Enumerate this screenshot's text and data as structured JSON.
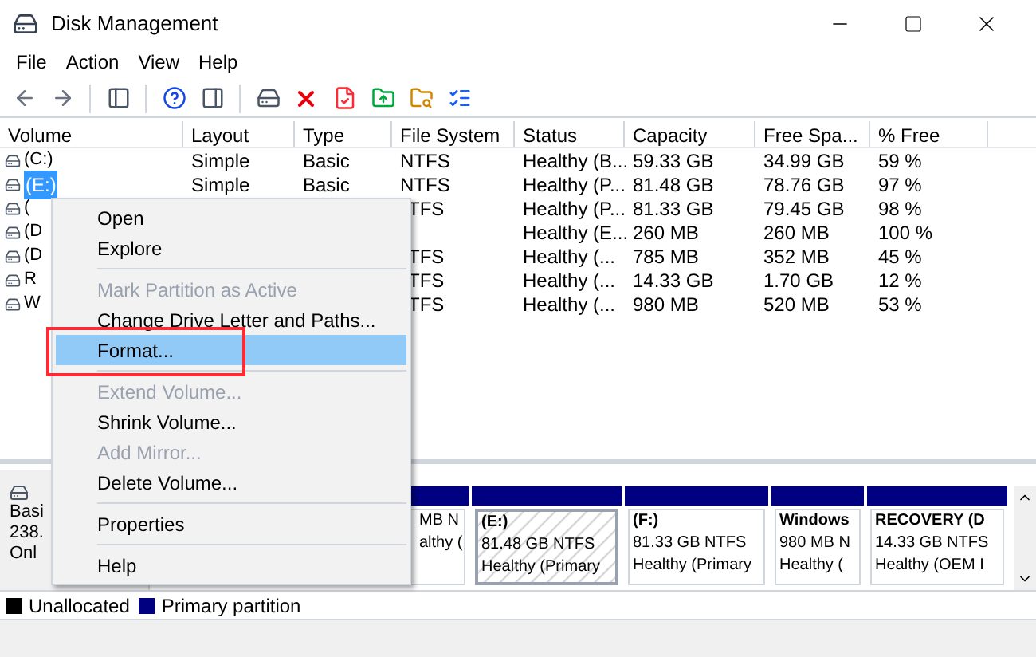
{
  "window": {
    "title": "Disk Management"
  },
  "menu_bar": [
    "File",
    "Action",
    "View",
    "Help"
  ],
  "table": {
    "columns": [
      "Volume",
      "Layout",
      "Type",
      "File System",
      "Status",
      "Capacity",
      "Free Spa...",
      "% Free"
    ],
    "rows": [
      {
        "selected": false,
        "volume": "(C:)",
        "layout": "Simple",
        "type": "Basic",
        "file_system": "NTFS",
        "status": "Healthy (B...",
        "capacity": "59.33 GB",
        "free_space": "34.99 GB",
        "percent_free": "59 %"
      },
      {
        "selected": true,
        "volume": "(E:)",
        "layout": "Simple",
        "type": "Basic",
        "file_system": "NTFS",
        "status": "Healthy (P...",
        "capacity": "81.48 GB",
        "free_space": "78.76 GB",
        "percent_free": "97 %"
      },
      {
        "selected": false,
        "volume": "(",
        "file_system": "TFS",
        "status": "Healthy (P...",
        "capacity": "81.33 GB",
        "free_space": "79.45 GB",
        "percent_free": "98 %"
      },
      {
        "selected": false,
        "volume": "(D",
        "status": "Healthy (E...",
        "capacity": "260 MB",
        "free_space": "260 MB",
        "percent_free": "100 %"
      },
      {
        "selected": false,
        "volume": "(D",
        "file_system": "TFS",
        "status": "Healthy (...",
        "capacity": "785 MB",
        "free_space": "352 MB",
        "percent_free": "45 %"
      },
      {
        "selected": false,
        "volume": "R",
        "file_system": "TFS",
        "status": "Healthy (...",
        "capacity": "14.33 GB",
        "free_space": "1.70 GB",
        "percent_free": "12 %"
      },
      {
        "selected": false,
        "volume": "W",
        "file_system": "TFS",
        "status": "Healthy (...",
        "capacity": "980 MB",
        "free_space": "520 MB",
        "percent_free": "53 %"
      }
    ]
  },
  "context_menu": [
    {
      "kind": "item",
      "label": "Open",
      "disabled": false,
      "selected": false,
      "outlined": false
    },
    {
      "kind": "item",
      "label": "Explore",
      "disabled": false,
      "selected": false,
      "outlined": false
    },
    {
      "kind": "separator"
    },
    {
      "kind": "item",
      "label": "Mark Partition as Active",
      "disabled": true,
      "selected": false,
      "outlined": false
    },
    {
      "kind": "item",
      "label": "Change Drive Letter and Paths...",
      "disabled": false,
      "selected": false,
      "outlined": false
    },
    {
      "kind": "item",
      "label": "Format...",
      "disabled": false,
      "selected": true,
      "outlined": true
    },
    {
      "kind": "separator"
    },
    {
      "kind": "item",
      "label": "Extend Volume...",
      "disabled": true,
      "selected": false,
      "outlined": false
    },
    {
      "kind": "item",
      "label": "Shrink Volume...",
      "disabled": false,
      "selected": false,
      "outlined": false
    },
    {
      "kind": "item",
      "label": "Add Mirror...",
      "disabled": true,
      "selected": false,
      "outlined": false
    },
    {
      "kind": "item",
      "label": "Delete Volume...",
      "disabled": false,
      "selected": false,
      "outlined": false
    },
    {
      "kind": "separator"
    },
    {
      "kind": "item",
      "label": "Properties",
      "disabled": false,
      "selected": false,
      "outlined": false
    },
    {
      "kind": "separator"
    },
    {
      "kind": "item",
      "label": "Help",
      "disabled": false,
      "selected": false,
      "outlined": false
    }
  ],
  "disk": {
    "lines": [
      "Basi",
      "238.",
      "Onl"
    ],
    "partitions": [
      {
        "kind": "fragment",
        "selected": false,
        "lines": [
          "MB N",
          "althy ("
        ]
      },
      {
        "kind": "full",
        "selected": true,
        "lines": [
          "(E:)",
          "81.48 GB NTFS",
          "Healthy (Primary"
        ]
      },
      {
        "kind": "full",
        "selected": false,
        "lines": [
          "(F:)",
          "81.33 GB NTFS",
          "Healthy (Primary"
        ]
      },
      {
        "kind": "full",
        "selected": false,
        "lines": [
          "Windows",
          "980 MB N",
          "Healthy ("
        ]
      },
      {
        "kind": "full",
        "selected": false,
        "lines": [
          "RECOVERY  (D",
          "14.33 GB NTFS",
          "Healthy (OEM I"
        ]
      }
    ]
  },
  "legend": [
    {
      "label": "Unallocated",
      "color": "#000000"
    },
    {
      "label": "Primary partition",
      "color": "#000080"
    }
  ]
}
